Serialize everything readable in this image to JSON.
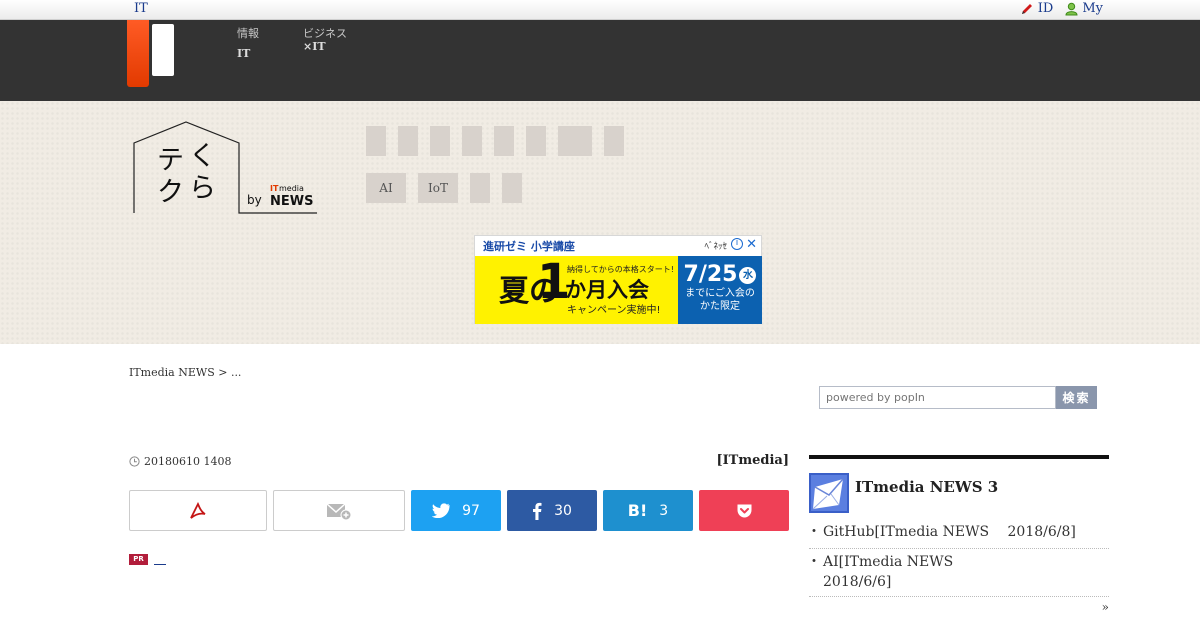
{
  "topbar": {
    "brand": "IT",
    "id_label": "ID",
    "my_label": "My"
  },
  "header": {
    "nav1_line1": "情報",
    "nav1_line2": "IT",
    "nav2_line1": "ビジネス",
    "nav2_line2": "×IT"
  },
  "categories": {
    "row2": [
      "AI",
      "IoT"
    ]
  },
  "ad": {
    "top_text": "進研ゼミ 小学講座",
    "headline_left": "夏の",
    "headline_number": "1",
    "headline_sub": "納得してからの本格スタート!",
    "headline_mid": "か月入会",
    "headline_bottom": "キャンペーン実施中!",
    "date": "7/25",
    "date_day": "水",
    "date_sub1": "までにご入会の",
    "date_sub2": "かた限定",
    "close": "✕",
    "info": "i"
  },
  "breadcrumb": "ITmedia NEWS > ...",
  "search": {
    "placeholder": "powered by popIn",
    "button": "検索"
  },
  "article": {
    "date": "20180610 1408",
    "author": "[ITmedia]"
  },
  "share": {
    "twitter_count": "97",
    "facebook_count": "30",
    "hatena_label": "B!",
    "hatena_count": "3"
  },
  "pr": {
    "badge": "PR"
  },
  "sidebar": {
    "title": "ITmedia NEWS 3",
    "items": [
      "GitHub[ITmedia NEWS　 2018/6/8]",
      "AI[ITmedia NEWS　 2018/6/6]"
    ],
    "more": "»"
  },
  "colors": {
    "header_bg": "#333333",
    "logo_accent": "#ff5b25",
    "twitter": "#1da1f2",
    "facebook": "#2d5aa3",
    "hatena": "#1e90cf",
    "pocket": "#ef4056"
  }
}
